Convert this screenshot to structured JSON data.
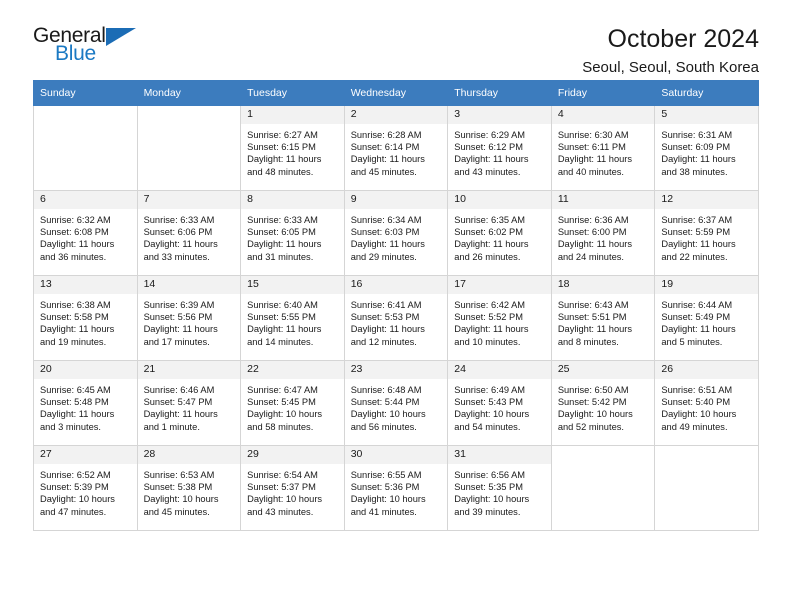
{
  "brand": {
    "name_part1": "General",
    "name_part2": "Blue",
    "triangle_color": "#1b6cb5",
    "blue_color": "#1b79c3"
  },
  "header": {
    "title": "October 2024",
    "subtitle": "Seoul, Seoul, South Korea"
  },
  "calendar": {
    "header_bg": "#3c7cbe",
    "daynum_bg": "#f2f2f2",
    "weekdays": [
      "Sunday",
      "Monday",
      "Tuesday",
      "Wednesday",
      "Thursday",
      "Friday",
      "Saturday"
    ],
    "weeks": [
      [
        {
          "day": "",
          "blank": true
        },
        {
          "day": "",
          "blank": true
        },
        {
          "day": "1",
          "sunrise": "Sunrise: 6:27 AM",
          "sunset": "Sunset: 6:15 PM",
          "daylight1": "Daylight: 11 hours",
          "daylight2": "and 48 minutes."
        },
        {
          "day": "2",
          "sunrise": "Sunrise: 6:28 AM",
          "sunset": "Sunset: 6:14 PM",
          "daylight1": "Daylight: 11 hours",
          "daylight2": "and 45 minutes."
        },
        {
          "day": "3",
          "sunrise": "Sunrise: 6:29 AM",
          "sunset": "Sunset: 6:12 PM",
          "daylight1": "Daylight: 11 hours",
          "daylight2": "and 43 minutes."
        },
        {
          "day": "4",
          "sunrise": "Sunrise: 6:30 AM",
          "sunset": "Sunset: 6:11 PM",
          "daylight1": "Daylight: 11 hours",
          "daylight2": "and 40 minutes."
        },
        {
          "day": "5",
          "sunrise": "Sunrise: 6:31 AM",
          "sunset": "Sunset: 6:09 PM",
          "daylight1": "Daylight: 11 hours",
          "daylight2": "and 38 minutes."
        }
      ],
      [
        {
          "day": "6",
          "sunrise": "Sunrise: 6:32 AM",
          "sunset": "Sunset: 6:08 PM",
          "daylight1": "Daylight: 11 hours",
          "daylight2": "and 36 minutes."
        },
        {
          "day": "7",
          "sunrise": "Sunrise: 6:33 AM",
          "sunset": "Sunset: 6:06 PM",
          "daylight1": "Daylight: 11 hours",
          "daylight2": "and 33 minutes."
        },
        {
          "day": "8",
          "sunrise": "Sunrise: 6:33 AM",
          "sunset": "Sunset: 6:05 PM",
          "daylight1": "Daylight: 11 hours",
          "daylight2": "and 31 minutes."
        },
        {
          "day": "9",
          "sunrise": "Sunrise: 6:34 AM",
          "sunset": "Sunset: 6:03 PM",
          "daylight1": "Daylight: 11 hours",
          "daylight2": "and 29 minutes."
        },
        {
          "day": "10",
          "sunrise": "Sunrise: 6:35 AM",
          "sunset": "Sunset: 6:02 PM",
          "daylight1": "Daylight: 11 hours",
          "daylight2": "and 26 minutes."
        },
        {
          "day": "11",
          "sunrise": "Sunrise: 6:36 AM",
          "sunset": "Sunset: 6:00 PM",
          "daylight1": "Daylight: 11 hours",
          "daylight2": "and 24 minutes."
        },
        {
          "day": "12",
          "sunrise": "Sunrise: 6:37 AM",
          "sunset": "Sunset: 5:59 PM",
          "daylight1": "Daylight: 11 hours",
          "daylight2": "and 22 minutes."
        }
      ],
      [
        {
          "day": "13",
          "sunrise": "Sunrise: 6:38 AM",
          "sunset": "Sunset: 5:58 PM",
          "daylight1": "Daylight: 11 hours",
          "daylight2": "and 19 minutes."
        },
        {
          "day": "14",
          "sunrise": "Sunrise: 6:39 AM",
          "sunset": "Sunset: 5:56 PM",
          "daylight1": "Daylight: 11 hours",
          "daylight2": "and 17 minutes."
        },
        {
          "day": "15",
          "sunrise": "Sunrise: 6:40 AM",
          "sunset": "Sunset: 5:55 PM",
          "daylight1": "Daylight: 11 hours",
          "daylight2": "and 14 minutes."
        },
        {
          "day": "16",
          "sunrise": "Sunrise: 6:41 AM",
          "sunset": "Sunset: 5:53 PM",
          "daylight1": "Daylight: 11 hours",
          "daylight2": "and 12 minutes."
        },
        {
          "day": "17",
          "sunrise": "Sunrise: 6:42 AM",
          "sunset": "Sunset: 5:52 PM",
          "daylight1": "Daylight: 11 hours",
          "daylight2": "and 10 minutes."
        },
        {
          "day": "18",
          "sunrise": "Sunrise: 6:43 AM",
          "sunset": "Sunset: 5:51 PM",
          "daylight1": "Daylight: 11 hours",
          "daylight2": "and 8 minutes."
        },
        {
          "day": "19",
          "sunrise": "Sunrise: 6:44 AM",
          "sunset": "Sunset: 5:49 PM",
          "daylight1": "Daylight: 11 hours",
          "daylight2": "and 5 minutes."
        }
      ],
      [
        {
          "day": "20",
          "sunrise": "Sunrise: 6:45 AM",
          "sunset": "Sunset: 5:48 PM",
          "daylight1": "Daylight: 11 hours",
          "daylight2": "and 3 minutes."
        },
        {
          "day": "21",
          "sunrise": "Sunrise: 6:46 AM",
          "sunset": "Sunset: 5:47 PM",
          "daylight1": "Daylight: 11 hours",
          "daylight2": "and 1 minute."
        },
        {
          "day": "22",
          "sunrise": "Sunrise: 6:47 AM",
          "sunset": "Sunset: 5:45 PM",
          "daylight1": "Daylight: 10 hours",
          "daylight2": "and 58 minutes."
        },
        {
          "day": "23",
          "sunrise": "Sunrise: 6:48 AM",
          "sunset": "Sunset: 5:44 PM",
          "daylight1": "Daylight: 10 hours",
          "daylight2": "and 56 minutes."
        },
        {
          "day": "24",
          "sunrise": "Sunrise: 6:49 AM",
          "sunset": "Sunset: 5:43 PM",
          "daylight1": "Daylight: 10 hours",
          "daylight2": "and 54 minutes."
        },
        {
          "day": "25",
          "sunrise": "Sunrise: 6:50 AM",
          "sunset": "Sunset: 5:42 PM",
          "daylight1": "Daylight: 10 hours",
          "daylight2": "and 52 minutes."
        },
        {
          "day": "26",
          "sunrise": "Sunrise: 6:51 AM",
          "sunset": "Sunset: 5:40 PM",
          "daylight1": "Daylight: 10 hours",
          "daylight2": "and 49 minutes."
        }
      ],
      [
        {
          "day": "27",
          "sunrise": "Sunrise: 6:52 AM",
          "sunset": "Sunset: 5:39 PM",
          "daylight1": "Daylight: 10 hours",
          "daylight2": "and 47 minutes."
        },
        {
          "day": "28",
          "sunrise": "Sunrise: 6:53 AM",
          "sunset": "Sunset: 5:38 PM",
          "daylight1": "Daylight: 10 hours",
          "daylight2": "and 45 minutes."
        },
        {
          "day": "29",
          "sunrise": "Sunrise: 6:54 AM",
          "sunset": "Sunset: 5:37 PM",
          "daylight1": "Daylight: 10 hours",
          "daylight2": "and 43 minutes."
        },
        {
          "day": "30",
          "sunrise": "Sunrise: 6:55 AM",
          "sunset": "Sunset: 5:36 PM",
          "daylight1": "Daylight: 10 hours",
          "daylight2": "and 41 minutes."
        },
        {
          "day": "31",
          "sunrise": "Sunrise: 6:56 AM",
          "sunset": "Sunset: 5:35 PM",
          "daylight1": "Daylight: 10 hours",
          "daylight2": "and 39 minutes."
        },
        {
          "day": "",
          "blank": true
        },
        {
          "day": "",
          "blank": true
        }
      ]
    ]
  }
}
